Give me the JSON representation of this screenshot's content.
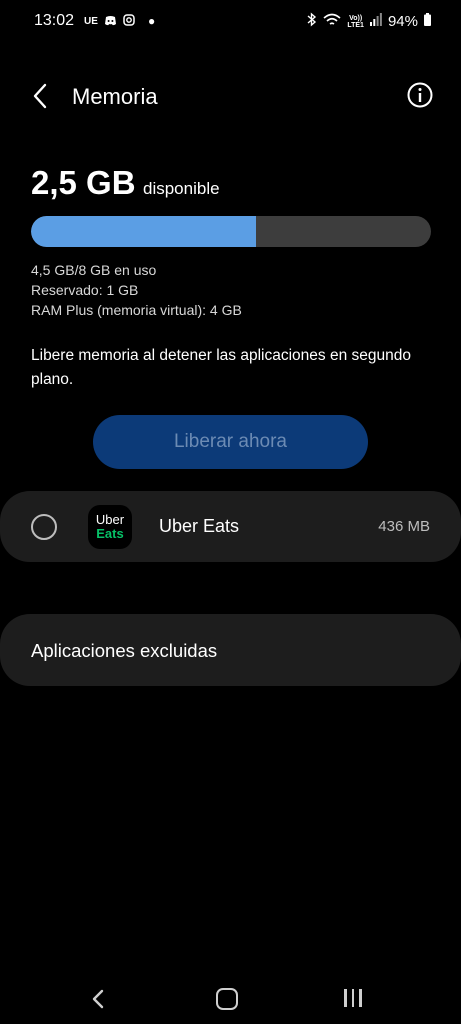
{
  "status_bar": {
    "time": "13:02",
    "left_icons": [
      "UE",
      "discord-icon",
      "instagram-icon"
    ],
    "volte_line1": "Vo))",
    "volte_line2": "LTE1",
    "battery_percent": "94%"
  },
  "header": {
    "title": "Memoria"
  },
  "memory": {
    "available_value": "2,5 GB",
    "available_label": "disponible",
    "used_fraction": 0.5625,
    "in_use": "4,5 GB/8 GB en uso",
    "reserved": "Reservado: 1 GB",
    "ram_plus": "RAM Plus (memoria virtual): 4 GB"
  },
  "hint": "Libere memoria al detener las aplicaciones en segundo plano.",
  "free_button_label": "Liberar ahora",
  "apps": [
    {
      "name": "Uber Eats",
      "size": "436 MB",
      "icon_line1": "Uber",
      "icon_line2": "Eats",
      "selected": false
    }
  ],
  "excluded_label": "Aplicaciones excluidas",
  "colors": {
    "accent_bar": "#5b9ee4",
    "button_bg": "#0c3a78",
    "card_bg": "#1d1d1d",
    "eats_green": "#06c167"
  }
}
